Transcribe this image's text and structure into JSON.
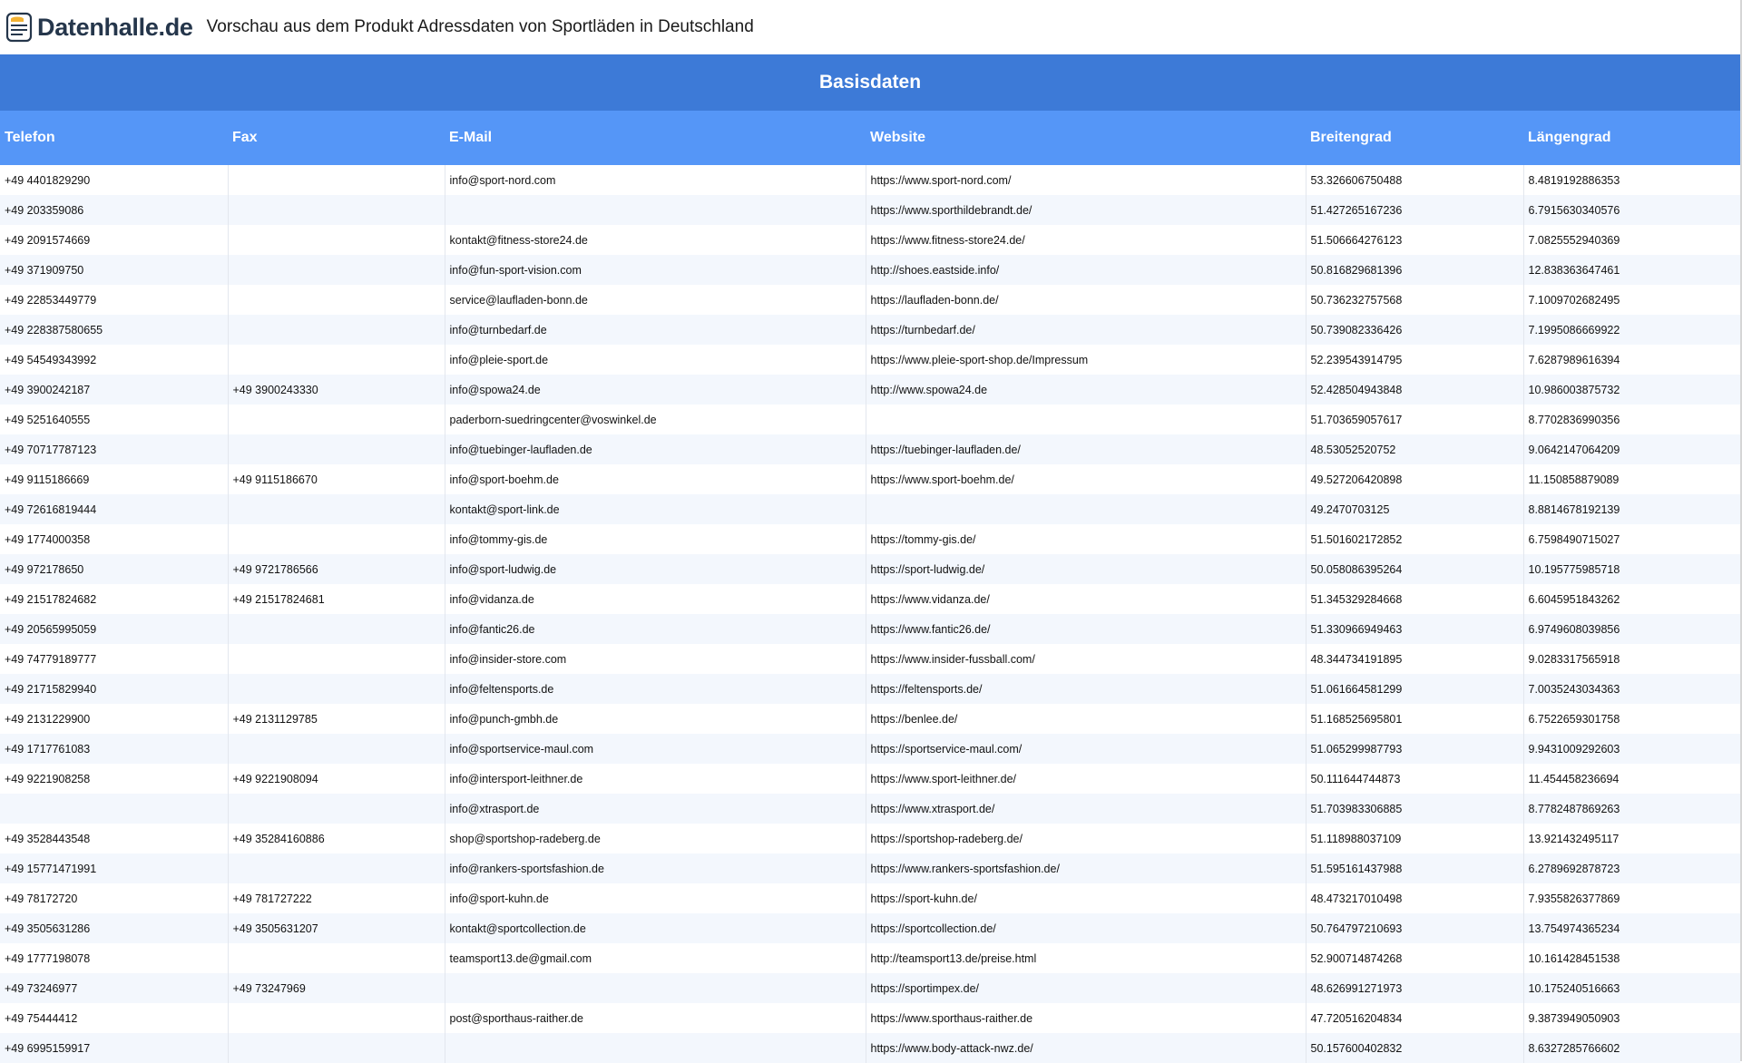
{
  "brand": {
    "name": "Datenhalle.de",
    "icon": "database-icon",
    "color": "#25364b"
  },
  "title": "Vorschau aus dem Produkt Adressdaten von Sportläden in Deutschland",
  "colors": {
    "group_header": "#3d7ad7",
    "column_header": "#5596f7",
    "row_alt": "#f3f7fd"
  },
  "table": {
    "group_header": "Basisdaten",
    "columns": [
      "Telefon",
      "Fax",
      "E-Mail",
      "Website",
      "Breitengrad",
      "Längengrad"
    ],
    "rows": [
      [
        "+49 4401829290",
        "",
        "info@sport-nord.com",
        "https://www.sport-nord.com/",
        "53.326606750488",
        "8.4819192886353"
      ],
      [
        "+49 203359086",
        "",
        "",
        "https://www.sporthildebrandt.de/",
        "51.427265167236",
        "6.7915630340576"
      ],
      [
        "+49 2091574669",
        "",
        "kontakt@fitness-store24.de",
        "https://www.fitness-store24.de/",
        "51.506664276123",
        "7.0825552940369"
      ],
      [
        "+49 371909750",
        "",
        "info@fun-sport-vision.com",
        "http://shoes.eastside.info/",
        "50.816829681396",
        "12.838363647461"
      ],
      [
        "+49 22853449779",
        "",
        "service@laufladen-bonn.de",
        "https://laufladen-bonn.de/",
        "50.736232757568",
        "7.1009702682495"
      ],
      [
        "+49 228387580655",
        "",
        "info@turnbedarf.de",
        "https://turnbedarf.de/",
        "50.739082336426",
        "7.1995086669922"
      ],
      [
        "+49 54549343992",
        "",
        "info@pleie-sport.de",
        "https://www.pleie-sport-shop.de/Impressum",
        "52.239543914795",
        "7.6287989616394"
      ],
      [
        "+49 3900242187",
        "+49 3900243330",
        "info@spowa24.de",
        "http://www.spowa24.de",
        "52.428504943848",
        "10.986003875732"
      ],
      [
        "+49 5251640555",
        "",
        "paderborn-suedringcenter@voswinkel.de",
        "",
        "51.703659057617",
        "8.7702836990356"
      ],
      [
        "+49 70717787123",
        "",
        "info@tuebinger-laufladen.de",
        "https://tuebinger-laufladen.de/",
        "48.53052520752",
        "9.0642147064209"
      ],
      [
        "+49 9115186669",
        "+49 9115186670",
        "info@sport-boehm.de",
        "https://www.sport-boehm.de/",
        "49.527206420898",
        "11.150858879089"
      ],
      [
        "+49 72616819444",
        "",
        "kontakt@sport-link.de",
        "",
        "49.2470703125",
        "8.8814678192139"
      ],
      [
        "+49 1774000358",
        "",
        "info@tommy-gis.de",
        "https://tommy-gis.de/",
        "51.501602172852",
        "6.7598490715027"
      ],
      [
        "+49 972178650",
        "+49 9721786566",
        "info@sport-ludwig.de",
        "https://sport-ludwig.de/",
        "50.058086395264",
        "10.195775985718"
      ],
      [
        "+49 21517824682",
        "+49 21517824681",
        "info@vidanza.de",
        "https://www.vidanza.de/",
        "51.345329284668",
        "6.6045951843262"
      ],
      [
        "+49 20565995059",
        "",
        "info@fantic26.de",
        "https://www.fantic26.de/",
        "51.330966949463",
        "6.9749608039856"
      ],
      [
        "+49 74779189777",
        "",
        "info@insider-store.com",
        "https://www.insider-fussball.com/",
        "48.344734191895",
        "9.0283317565918"
      ],
      [
        "+49 21715829940",
        "",
        "info@feltensports.de",
        "https://feltensports.de/",
        "51.061664581299",
        "7.0035243034363"
      ],
      [
        "+49 2131229900",
        "+49 2131129785",
        "info@punch-gmbh.de",
        "https://benlee.de/",
        "51.168525695801",
        "6.7522659301758"
      ],
      [
        "+49 1717761083",
        "",
        "info@sportservice-maul.com",
        "https://sportservice-maul.com/",
        "51.065299987793",
        "9.9431009292603"
      ],
      [
        "+49 9221908258",
        "+49 9221908094",
        "info@intersport-leithner.de",
        "https://www.sport-leithner.de/",
        "50.111644744873",
        "11.454458236694"
      ],
      [
        "",
        "",
        "info@xtrasport.de",
        "https://www.xtrasport.de/",
        "51.703983306885",
        "8.7782487869263"
      ],
      [
        "+49 3528443548",
        "+49 35284160886",
        "shop@sportshop-radeberg.de",
        "https://sportshop-radeberg.de/",
        "51.118988037109",
        "13.921432495117"
      ],
      [
        "+49 15771471991",
        "",
        "info@rankers-sportsfashion.de",
        "https://www.rankers-sportsfashion.de/",
        "51.595161437988",
        "6.2789692878723"
      ],
      [
        "+49 78172720",
        "+49 781727222",
        "info@sport-kuhn.de",
        "https://sport-kuhn.de/",
        "48.473217010498",
        "7.9355826377869"
      ],
      [
        "+49 3505631286",
        "+49 3505631207",
        "kontakt@sportcollection.de",
        "https://sportcollection.de/",
        "50.764797210693",
        "13.754974365234"
      ],
      [
        "+49 1777198078",
        "",
        "teamsport13.de@gmail.com",
        "http://teamsport13.de/preise.html",
        "52.900714874268",
        "10.161428451538"
      ],
      [
        "+49 73246977",
        "+49 73247969",
        "",
        "https://sportimpex.de/",
        "48.626991271973",
        "10.175240516663"
      ],
      [
        "+49 75444412",
        "",
        "post@sporthaus-raither.de",
        "https://www.sporthaus-raither.de",
        "47.720516204834",
        "9.3873949050903"
      ],
      [
        "+49 6995159917",
        "",
        "",
        "https://www.body-attack-nwz.de/",
        "50.157600402832",
        "8.6327285766602"
      ]
    ]
  }
}
